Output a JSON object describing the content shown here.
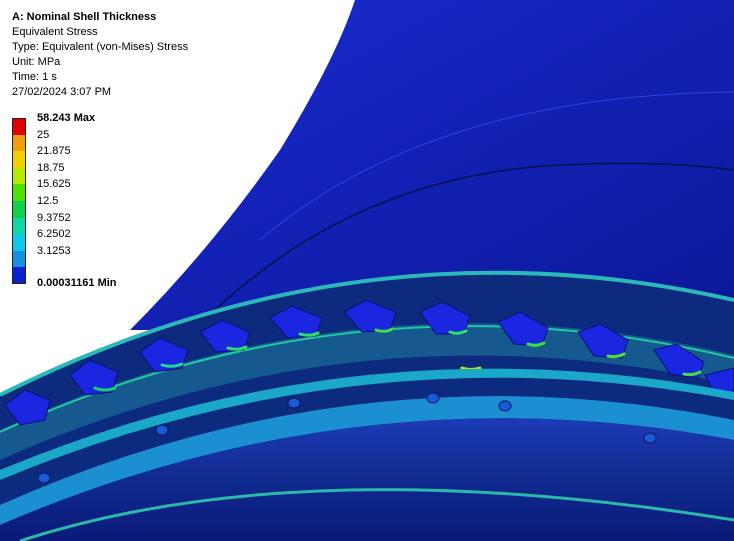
{
  "result": {
    "title": "A: Nominal Shell Thickness",
    "result_name": "Equivalent Stress",
    "type": "Type: Equivalent (von-Mises) Stress",
    "unit": "Unit: MPa",
    "time": "Time: 1 s",
    "date": "27/02/2024 3:07 PM"
  },
  "legend": {
    "bands": [
      {
        "label": "58.243 Max",
        "color": "#e00000"
      },
      {
        "label": "25",
        "color": "#f39c12"
      },
      {
        "label": "21.875",
        "color": "#f1d000"
      },
      {
        "label": "18.75",
        "color": "#b8ea00"
      },
      {
        "label": "15.625",
        "color": "#4de300"
      },
      {
        "label": "12.5",
        "color": "#10d24a"
      },
      {
        "label": "9.3752",
        "color": "#12d6a6"
      },
      {
        "label": "6.2502",
        "color": "#10c8e8"
      },
      {
        "label": "3.1253",
        "color": "#1790e0"
      }
    ],
    "min_label": "0.00031161 Min",
    "min_color": "#0b20d0"
  }
}
